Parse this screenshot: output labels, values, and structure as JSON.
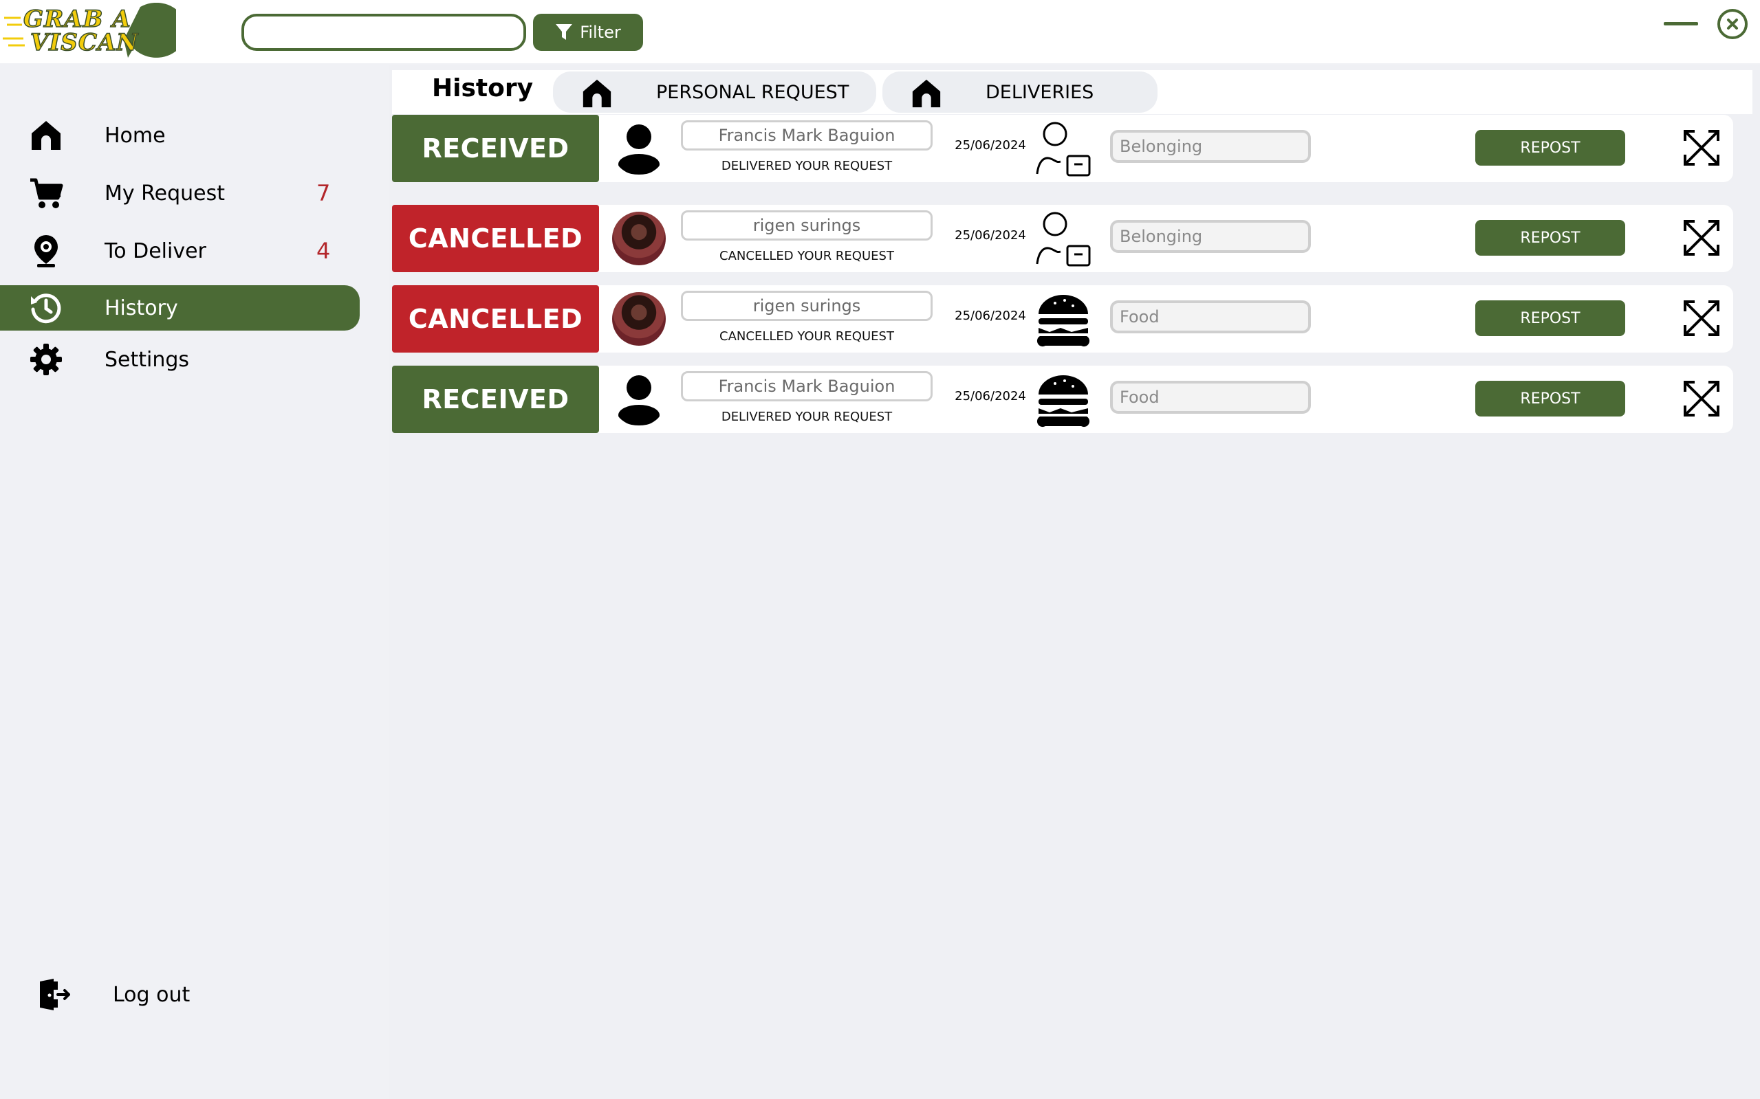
{
  "app": {
    "logo_line1": "GRAB A",
    "logo_line2": "VISCAN",
    "accent_color": "#4b6a35",
    "cancel_color": "#c0232a"
  },
  "topbar": {
    "search_value": "",
    "filter_label": "Filter"
  },
  "sidebar": {
    "items": [
      {
        "label": "Home",
        "icon": "home-icon",
        "count": ""
      },
      {
        "label": "My Request",
        "icon": "cart-icon",
        "count": "7"
      },
      {
        "label": "To Deliver",
        "icon": "location-pin-icon",
        "count": "4"
      },
      {
        "label": "History",
        "icon": "history-icon",
        "count": "",
        "active": true
      },
      {
        "label": "Settings",
        "icon": "gear-icon",
        "count": ""
      }
    ],
    "logout_label": "Log out"
  },
  "main": {
    "title": "History",
    "tabs": [
      {
        "label": "PERSONAL REQUEST",
        "icon": "home-icon"
      },
      {
        "label": "DELIVERIES",
        "icon": "home-icon"
      }
    ],
    "rows": [
      {
        "status": "RECEIVED",
        "avatar": "person-silhouette",
        "name": "Francis Mark Baguion",
        "message": "DELIVERED YOUR REQUEST",
        "date": "25/06/2024",
        "category_icon": "belonging-icon",
        "category": "Belonging",
        "action": "REPOST"
      },
      {
        "status": "CANCELLED",
        "avatar": "photo",
        "name": "rigen surings",
        "message": "CANCELLED YOUR REQUEST",
        "date": "25/06/2024",
        "category_icon": "belonging-icon",
        "category": "Belonging",
        "action": "REPOST"
      },
      {
        "status": "CANCELLED",
        "avatar": "photo",
        "name": "rigen surings",
        "message": "CANCELLED YOUR REQUEST",
        "date": "25/06/2024",
        "category_icon": "burger-icon",
        "category": "Food",
        "action": "REPOST"
      },
      {
        "status": "RECEIVED",
        "avatar": "person-silhouette",
        "name": "Francis Mark Baguion",
        "message": "DELIVERED YOUR REQUEST",
        "date": "25/06/2024",
        "category_icon": "burger-icon",
        "category": "Food",
        "action": "REPOST"
      }
    ]
  }
}
